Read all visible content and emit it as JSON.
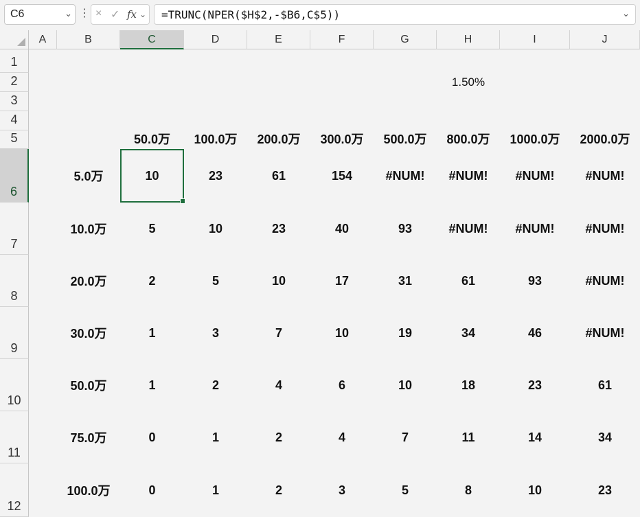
{
  "name_box": "C6",
  "formula": "=TRUNC(NPER($H$2,-$B6,C$5))",
  "icons": {
    "cancel": "×",
    "enter": "✓",
    "fx": "fx",
    "dropdown": "⌄",
    "more": "⋮"
  },
  "columns": [
    "A",
    "B",
    "C",
    "D",
    "E",
    "F",
    "G",
    "H",
    "I",
    "J"
  ],
  "rows": [
    "1",
    "2",
    "3",
    "4",
    "5",
    "6",
    "7",
    "8",
    "9",
    "10",
    "11",
    "12"
  ],
  "selected_cell": {
    "col": "C",
    "row": "6"
  },
  "rate": "1.50%",
  "amount_headers": [
    "50.0万",
    "100.0万",
    "200.0万",
    "300.0万",
    "500.0万",
    "800.0万",
    "1000.0万",
    "2000.0万"
  ],
  "payments": [
    "5.0万",
    "10.0万",
    "20.0万",
    "30.0万",
    "50.0万",
    "75.0万",
    "100.0万"
  ],
  "table": [
    [
      "10",
      "23",
      "61",
      "154",
      "#NUM!",
      "#NUM!",
      "#NUM!",
      "#NUM!"
    ],
    [
      "5",
      "10",
      "23",
      "40",
      "93",
      "#NUM!",
      "#NUM!",
      "#NUM!"
    ],
    [
      "2",
      "5",
      "10",
      "17",
      "31",
      "61",
      "93",
      "#NUM!"
    ],
    [
      "1",
      "3",
      "7",
      "10",
      "19",
      "34",
      "46",
      "#NUM!"
    ],
    [
      "1",
      "2",
      "4",
      "6",
      "10",
      "18",
      "23",
      "61"
    ],
    [
      "0",
      "1",
      "2",
      "4",
      "7",
      "11",
      "14",
      "34"
    ],
    [
      "0",
      "1",
      "2",
      "3",
      "5",
      "8",
      "10",
      "23"
    ]
  ]
}
